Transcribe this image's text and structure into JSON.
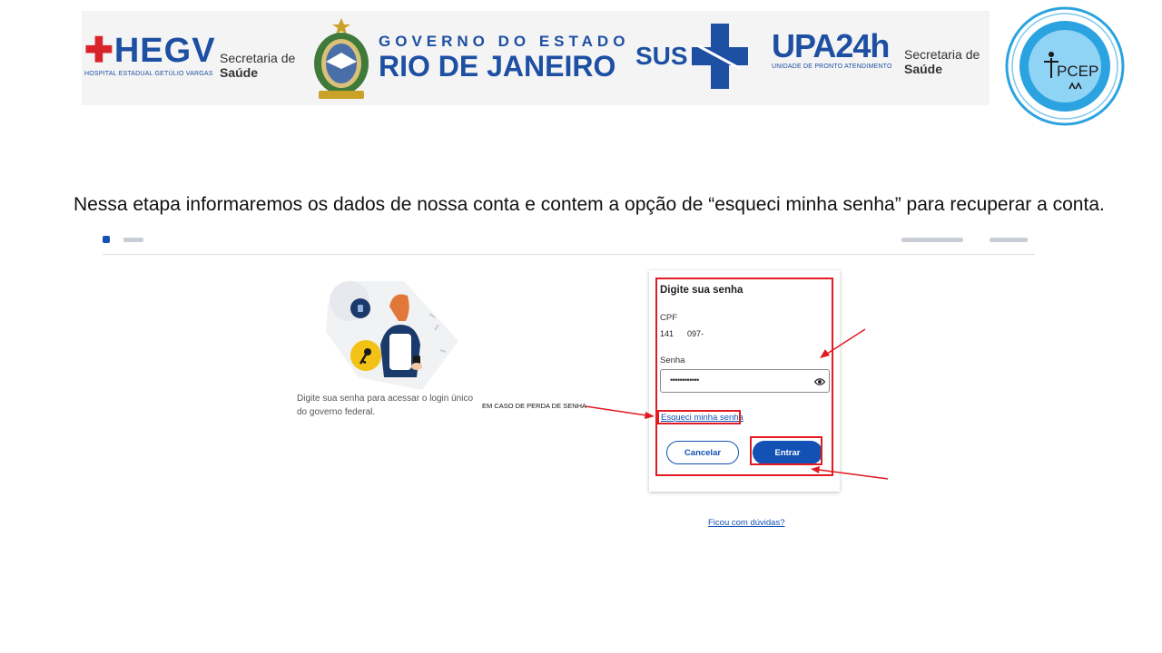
{
  "logos": {
    "hegv": {
      "name": "HEGV",
      "subtitle": "HOSPITAL ESTADUAL GETÚLIO VARGAS"
    },
    "secretaria_left": {
      "line1": "Secretaria de",
      "line2": "Saúde"
    },
    "governo": {
      "line1": "GOVERNO DO ESTADO",
      "line2": "RIO DE JANEIRO"
    },
    "sus": {
      "name": "SUS"
    },
    "upa": {
      "name": "UPA24h",
      "subtitle": "UNIDADE DE PRONTO ATENDIMENTO"
    },
    "secretaria_right": {
      "line1": "Secretaria de",
      "line2": "Saúde"
    },
    "pcep": {
      "name": "PCEP"
    }
  },
  "caption": "Nessa etapa informaremos os dados de nossa conta e contem a opção de “esqueci minha senha” para recuperar a conta.",
  "illustration": {
    "text": "Digite sua senha para acessar o login único do governo federal."
  },
  "annotation": {
    "label": "EM CASO DE PERDA DE SENHA"
  },
  "login_card": {
    "title": "Digite sua senha",
    "cpf_label": "CPF",
    "cpf_value": "141      097-",
    "password_label": "Senha",
    "password_value": "••••••••••••",
    "forgot_link": "Esqueci minha senha",
    "cancel_button": "Cancelar",
    "submit_button": "Entrar"
  },
  "help_link": "Ficou com dúvidas?",
  "colors": {
    "accent": "#1351b4",
    "highlight": "#e11b22",
    "brand_blue": "#1d4fa3"
  },
  "icons": {
    "password_toggle": "eye-icon",
    "key": "key-icon",
    "lock": "lock-icon"
  }
}
